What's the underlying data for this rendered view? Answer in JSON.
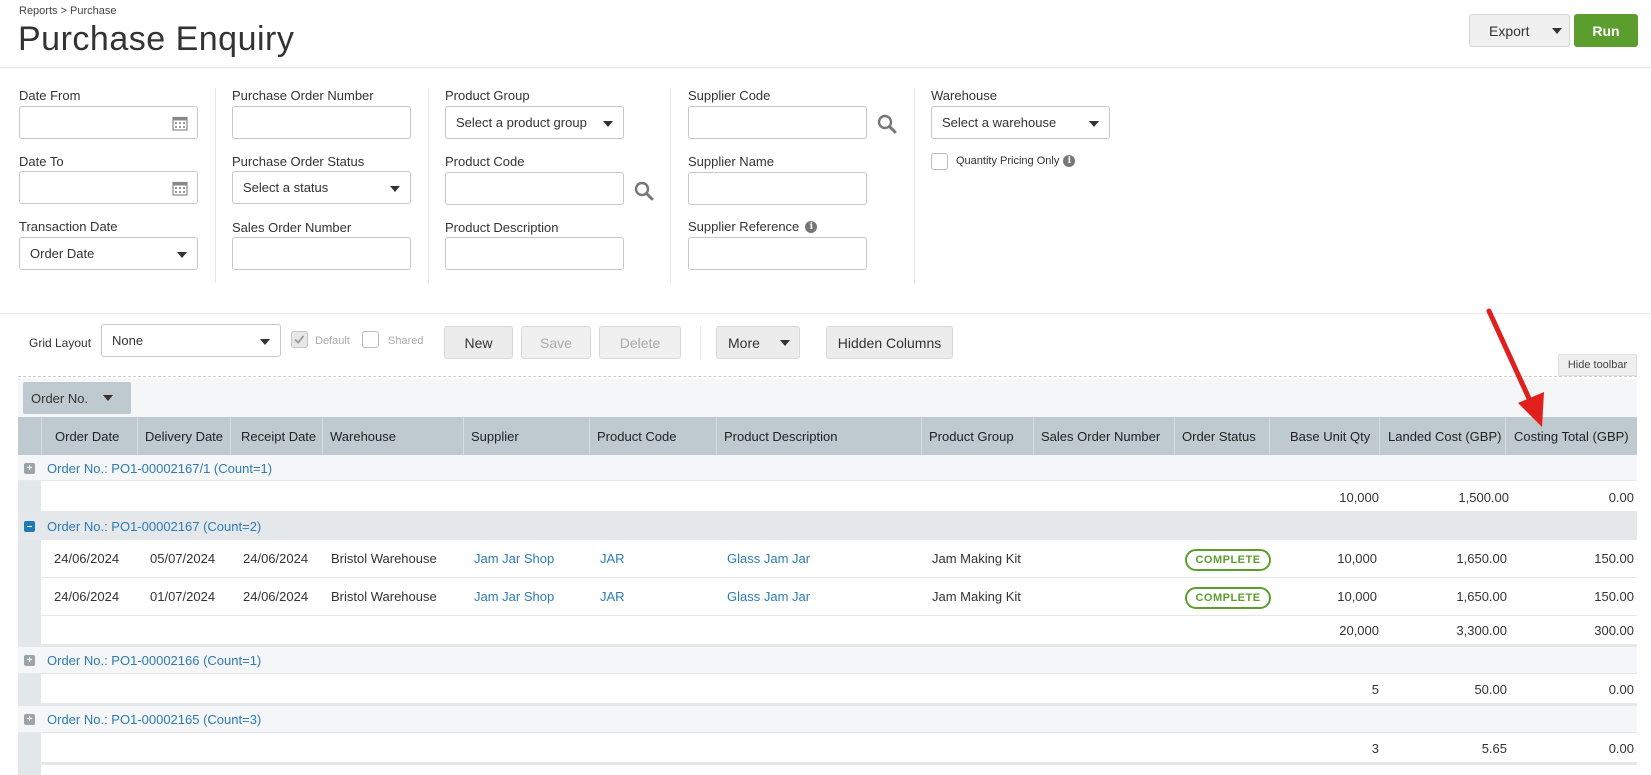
{
  "header": {
    "breadcrumb": "Reports > Purchase",
    "title": "Purchase Enquiry",
    "export_label": "Export",
    "run_label": "Run"
  },
  "filters": {
    "date_from": "Date From",
    "date_to": "Date To",
    "transaction_date": "Transaction Date",
    "transaction_date_value": "Order Date",
    "po_number": "Purchase Order Number",
    "po_status": "Purchase Order Status",
    "po_status_value": "Select a status",
    "sales_order_number": "Sales Order Number",
    "product_group": "Product Group",
    "product_group_value": "Select a product group",
    "product_code": "Product Code",
    "product_description": "Product Description",
    "supplier_code": "Supplier Code",
    "supplier_name": "Supplier Name",
    "supplier_reference": "Supplier Reference",
    "warehouse": "Warehouse",
    "warehouse_value": "Select a warehouse",
    "quantity_pricing_only": "Quantity Pricing Only"
  },
  "toolbar": {
    "grid_layout": "Grid Layout",
    "grid_layout_value": "None",
    "default_label": "Default",
    "shared_label": "Shared",
    "new_label": "New",
    "save_label": "Save",
    "delete_label": "Delete",
    "more_label": "More",
    "hidden_columns_label": "Hidden Columns",
    "hide_toolbar_label": "Hide toolbar",
    "group_by_label": "Order No."
  },
  "table": {
    "columns": [
      "Order Date",
      "Delivery Date",
      "Receipt Date",
      "Warehouse",
      "Supplier",
      "Product Code",
      "Product Description",
      "Product Group",
      "Sales Order Number",
      "Order Status",
      "Base Unit Qty",
      "Landed Cost (GBP)",
      "Costing Total (GBP)"
    ],
    "groups": [
      {
        "label": "Order No.: PO1-00002167/1 (Count=1)",
        "totals": [
          "10,000",
          "1,500.00",
          "0.00"
        ]
      },
      {
        "label": "Order No.: PO1-00002167 (Count=2)",
        "rows": [
          {
            "order_date": "24/06/2024",
            "delivery_date": "05/07/2024",
            "receipt_date": "24/06/2024",
            "warehouse": "Bristol Warehouse",
            "supplier": "Jam Jar Shop",
            "product_code": "JAR",
            "product_description": "Glass Jam Jar",
            "product_group": "Jam Making Kit",
            "status": "COMPLETE",
            "qty": "10,000",
            "landed": "1,650.00",
            "costing": "150.00"
          },
          {
            "order_date": "24/06/2024",
            "delivery_date": "01/07/2024",
            "receipt_date": "24/06/2024",
            "warehouse": "Bristol Warehouse",
            "supplier": "Jam Jar Shop",
            "product_code": "JAR",
            "product_description": "Glass Jam Jar",
            "product_group": "Jam Making Kit",
            "status": "COMPLETE",
            "qty": "10,000",
            "landed": "1,650.00",
            "costing": "150.00"
          }
        ],
        "totals": [
          "20,000",
          "3,300.00",
          "300.00"
        ]
      },
      {
        "label": "Order No.: PO1-00002166 (Count=1)",
        "totals": [
          "5",
          "50.00",
          "0.00"
        ]
      },
      {
        "label": "Order No.: PO1-00002165 (Count=3)",
        "totals": [
          "3",
          "5.65",
          "0.00"
        ]
      }
    ]
  },
  "colors": {
    "accent_green": "#5c9e2e",
    "link_blue": "#2e7bb4",
    "header_grey": "#bfc9d0",
    "annotation_red": "#e0201c"
  }
}
